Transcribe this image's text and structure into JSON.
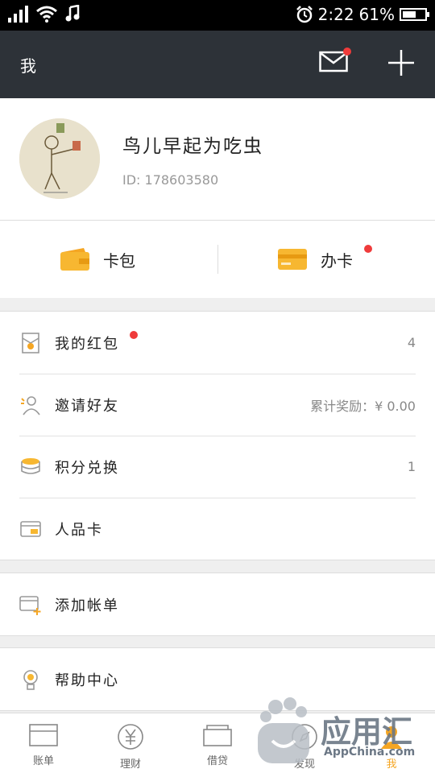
{
  "status_bar": {
    "time": "2:22",
    "battery_percent": "61%",
    "battery_level": 0.61
  },
  "nav": {
    "title": "我"
  },
  "profile": {
    "nickname": "鸟儿早起为吃虫",
    "user_id": "ID: 178603580"
  },
  "quick_actions": [
    {
      "label": "卡包",
      "icon": "wallet-icon"
    },
    {
      "label": "办卡",
      "icon": "card-icon"
    }
  ],
  "menu_group_1": [
    {
      "label": "我的红包",
      "value": "4",
      "icon": "red-packet-icon"
    },
    {
      "label": "邀请好友",
      "value": "累计奖励：¥ 0.00",
      "icon": "invite-friend-icon"
    },
    {
      "label": "积分兑换",
      "value": "1",
      "icon": "coins-icon"
    },
    {
      "label": "人品卡",
      "value": "",
      "icon": "rp-card-icon"
    }
  ],
  "menu_group_2": [
    {
      "label": "添加帐单",
      "icon": "add-bill-icon"
    }
  ],
  "menu_group_3": [
    {
      "label": "帮助中心",
      "icon": "lightbulb-icon"
    }
  ],
  "tabs": [
    {
      "label": "账单",
      "icon": "bill-icon"
    },
    {
      "label": "理财",
      "icon": "yuan-icon"
    },
    {
      "label": "借贷",
      "icon": "loan-icon"
    },
    {
      "label": "发现",
      "icon": "discover-icon"
    },
    {
      "label": "我",
      "icon": "me-icon"
    }
  ],
  "watermark": {
    "text": "应用汇",
    "subtext": "AppChina.com"
  },
  "colors": {
    "nav_bg": "#2d3238",
    "accent": "#f5a623",
    "badge": "#ef3b3b"
  }
}
